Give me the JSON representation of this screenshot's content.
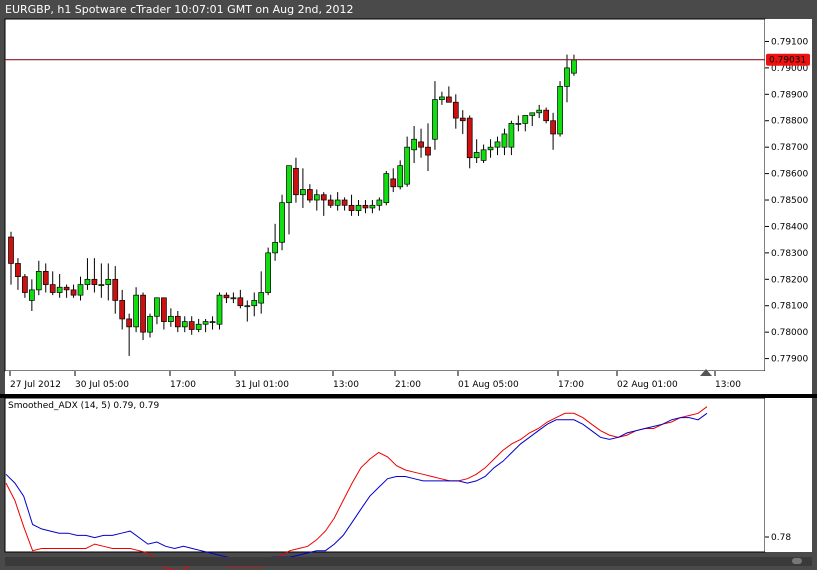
{
  "window": {
    "title": "EURGBP, h1 Spotware cTrader 10:07:01 GMT on Aug 2nd, 2012"
  },
  "colors": {
    "bull": "#11dd11",
    "bear": "#cc1111",
    "wick": "#000000",
    "price_line": "#8b1a2a",
    "price_tag": "#ee1111",
    "adx_red": "#ee0000",
    "adx_blue": "#0000cc",
    "frame": "#4a4a4a"
  },
  "chart_data": [
    {
      "type": "candlestick",
      "symbol": "EURGBP",
      "timeframe": "h1",
      "ylim": [
        0.7785,
        0.7915
      ],
      "y_ticks": [
        "0.79100",
        "0.79000",
        "0.78900",
        "0.78800",
        "0.78700",
        "0.78600",
        "0.78500",
        "0.78400",
        "0.78300",
        "0.78200",
        "0.78100",
        "0.78000",
        "0.77900"
      ],
      "x_ticks": [
        "27 Jul 2012",
        "30 Jul 05:00",
        "17:00",
        "31 Jul 01:00",
        "13:00",
        "21:00",
        "01 Aug 05:00",
        "17:00",
        "02 Aug 01:00",
        "13:00"
      ],
      "current_price": "0.79031",
      "candles": [
        [
          0.7836,
          0.7838,
          0.7818,
          0.7826
        ],
        [
          0.7826,
          0.7828,
          0.7816,
          0.7821
        ],
        [
          0.7821,
          0.7822,
          0.7813,
          0.7815
        ],
        [
          0.7812,
          0.782,
          0.7808,
          0.7816
        ],
        [
          0.7816,
          0.7827,
          0.7814,
          0.7823
        ],
        [
          0.7823,
          0.7826,
          0.7815,
          0.7818
        ],
        [
          0.7818,
          0.7823,
          0.7814,
          0.7815
        ],
        [
          0.7815,
          0.7822,
          0.7813,
          0.7817
        ],
        [
          0.7817,
          0.7818,
          0.7813,
          0.7816
        ],
        [
          0.7816,
          0.7818,
          0.7813,
          0.7814
        ],
        [
          0.7814,
          0.7821,
          0.7812,
          0.7818
        ],
        [
          0.7818,
          0.7828,
          0.7816,
          0.782
        ],
        [
          0.782,
          0.7828,
          0.7815,
          0.7818
        ],
        [
          0.7818,
          0.7826,
          0.7813,
          0.7818
        ],
        [
          0.7818,
          0.7826,
          0.7812,
          0.782
        ],
        [
          0.782,
          0.7825,
          0.7807,
          0.7812
        ],
        [
          0.7812,
          0.7816,
          0.7801,
          0.7805
        ],
        [
          0.7805,
          0.7807,
          0.7791,
          0.7802
        ],
        [
          0.7802,
          0.7817,
          0.78,
          0.7814
        ],
        [
          0.7814,
          0.7815,
          0.7797,
          0.78
        ],
        [
          0.78,
          0.7807,
          0.7798,
          0.7806
        ],
        [
          0.7806,
          0.7813,
          0.7803,
          0.7813
        ],
        [
          0.7813,
          0.7813,
          0.7801,
          0.7804
        ],
        [
          0.7804,
          0.7809,
          0.7802,
          0.7806
        ],
        [
          0.7806,
          0.7808,
          0.78,
          0.7802
        ],
        [
          0.7802,
          0.7806,
          0.78,
          0.7804
        ],
        [
          0.7804,
          0.7806,
          0.7799,
          0.7801
        ],
        [
          0.7801,
          0.7805,
          0.78,
          0.7803
        ],
        [
          0.7803,
          0.7805,
          0.78,
          0.7804
        ],
        [
          0.7804,
          0.7806,
          0.7801,
          0.7804
        ],
        [
          0.7803,
          0.7815,
          0.7801,
          0.7814
        ],
        [
          0.7814,
          0.7815,
          0.7811,
          0.7813
        ],
        [
          0.7813,
          0.7815,
          0.7811,
          0.7813
        ],
        [
          0.7813,
          0.7816,
          0.7809,
          0.781
        ],
        [
          0.781,
          0.7812,
          0.7804,
          0.781
        ],
        [
          0.781,
          0.7815,
          0.7806,
          0.7812
        ],
        [
          0.7811,
          0.7823,
          0.7807,
          0.7815
        ],
        [
          0.7815,
          0.7832,
          0.7814,
          0.783
        ],
        [
          0.783,
          0.7841,
          0.7827,
          0.7834
        ],
        [
          0.7834,
          0.7852,
          0.7831,
          0.7849
        ],
        [
          0.7849,
          0.7862,
          0.7837,
          0.7863
        ],
        [
          0.7862,
          0.7866,
          0.7849,
          0.7852
        ],
        [
          0.7852,
          0.7862,
          0.7847,
          0.7854
        ],
        [
          0.7854,
          0.7856,
          0.7849,
          0.785
        ],
        [
          0.785,
          0.7854,
          0.7846,
          0.7852
        ],
        [
          0.7852,
          0.7853,
          0.7844,
          0.785
        ],
        [
          0.785,
          0.7852,
          0.7847,
          0.7848
        ],
        [
          0.7848,
          0.7853,
          0.7846,
          0.785
        ],
        [
          0.785,
          0.7851,
          0.7846,
          0.7848
        ],
        [
          0.7848,
          0.7852,
          0.7844,
          0.7846
        ],
        [
          0.7846,
          0.785,
          0.7844,
          0.7848
        ],
        [
          0.7848,
          0.785,
          0.7845,
          0.7847
        ],
        [
          0.7847,
          0.785,
          0.7845,
          0.7848
        ],
        [
          0.7848,
          0.7851,
          0.7846,
          0.785
        ],
        [
          0.7849,
          0.7861,
          0.7848,
          0.786
        ],
        [
          0.7858,
          0.7862,
          0.7853,
          0.7855
        ],
        [
          0.7855,
          0.7865,
          0.7854,
          0.7863
        ],
        [
          0.7856,
          0.7874,
          0.7855,
          0.787
        ],
        [
          0.7869,
          0.7878,
          0.7864,
          0.7873
        ],
        [
          0.7872,
          0.7877,
          0.7866,
          0.787
        ],
        [
          0.787,
          0.7879,
          0.7861,
          0.7867
        ],
        [
          0.7873,
          0.7895,
          0.7869,
          0.7888
        ],
        [
          0.7888,
          0.7891,
          0.7886,
          0.7889
        ],
        [
          0.7889,
          0.7893,
          0.7887,
          0.7887
        ],
        [
          0.7887,
          0.789,
          0.7877,
          0.7881
        ],
        [
          0.7881,
          0.7884,
          0.7875,
          0.788
        ],
        [
          0.7881,
          0.7882,
          0.7862,
          0.7866
        ],
        [
          0.7866,
          0.7873,
          0.7864,
          0.7868
        ],
        [
          0.7865,
          0.7871,
          0.7864,
          0.7869
        ],
        [
          0.7869,
          0.7873,
          0.7866,
          0.787
        ],
        [
          0.787,
          0.7874,
          0.7867,
          0.7872
        ],
        [
          0.787,
          0.7877,
          0.7867,
          0.7875
        ],
        [
          0.787,
          0.788,
          0.7867,
          0.7879
        ],
        [
          0.7879,
          0.7882,
          0.7876,
          0.7879
        ],
        [
          0.7879,
          0.7882,
          0.7876,
          0.7882
        ],
        [
          0.7882,
          0.7883,
          0.7878,
          0.7883
        ],
        [
          0.7883,
          0.7886,
          0.7881,
          0.7884
        ],
        [
          0.7884,
          0.7885,
          0.7879,
          0.788
        ],
        [
          0.788,
          0.7883,
          0.7869,
          0.7875
        ],
        [
          0.7875,
          0.7895,
          0.7874,
          0.7893
        ],
        [
          0.7893,
          0.7905,
          0.7887,
          0.79
        ],
        [
          0.7898,
          0.7905,
          0.7897,
          0.7903
        ]
      ]
    },
    {
      "type": "line",
      "label": "Smoothed_ADX (14, 5) 0.79, 0.79",
      "y_ticks": [
        "0.78"
      ],
      "series": [
        {
          "color": "red",
          "values": [
            0.79,
            0.786,
            0.78,
            0.7745,
            0.775,
            0.775,
            0.775,
            0.775,
            0.775,
            0.775,
            0.776,
            0.7755,
            0.775,
            0.775,
            0.775,
            0.7745,
            0.774,
            0.7725,
            0.7705,
            0.77,
            0.77,
            0.7715,
            0.7715,
            0.7715,
            0.7715,
            0.771,
            0.771,
            0.771,
            0.771,
            0.771,
            0.772,
            0.7735,
            0.7745,
            0.775,
            0.7755,
            0.777,
            0.779,
            0.782,
            0.786,
            0.79,
            0.7935,
            0.7955,
            0.797,
            0.796,
            0.794,
            0.793,
            0.7925,
            0.792,
            0.7915,
            0.791,
            0.7905,
            0.7905,
            0.791,
            0.792,
            0.7935,
            0.7955,
            0.7975,
            0.799,
            0.8,
            0.8015,
            0.8025,
            0.804,
            0.805,
            0.806,
            0.806,
            0.805,
            0.8035,
            0.802,
            0.801,
            0.8005,
            0.801,
            0.802,
            0.8025,
            0.8025,
            0.8035,
            0.804,
            0.805,
            0.8055,
            0.806,
            0.8075
          ]
        },
        {
          "color": "blue",
          "values": [
            0.792,
            0.79,
            0.787,
            0.7805,
            0.7795,
            0.779,
            0.7785,
            0.7785,
            0.778,
            0.778,
            0.7775,
            0.778,
            0.778,
            0.7785,
            0.779,
            0.7775,
            0.776,
            0.7765,
            0.7755,
            0.775,
            0.7755,
            0.775,
            0.7745,
            0.774,
            0.7735,
            0.773,
            0.7725,
            0.7725,
            0.7725,
            0.7725,
            0.773,
            0.773,
            0.773,
            0.7735,
            0.774,
            0.7745,
            0.7745,
            0.776,
            0.778,
            0.781,
            0.784,
            0.787,
            0.789,
            0.791,
            0.7915,
            0.7915,
            0.791,
            0.7905,
            0.7905,
            0.7905,
            0.7905,
            0.7905,
            0.79,
            0.7905,
            0.7915,
            0.7935,
            0.795,
            0.797,
            0.799,
            0.8005,
            0.802,
            0.8035,
            0.8045,
            0.8045,
            0.8045,
            0.8035,
            0.802,
            0.8005,
            0.8,
            0.8005,
            0.8015,
            0.802,
            0.8025,
            0.803,
            0.8035,
            0.8045,
            0.805,
            0.805,
            0.8045,
            0.806
          ]
        }
      ]
    }
  ]
}
